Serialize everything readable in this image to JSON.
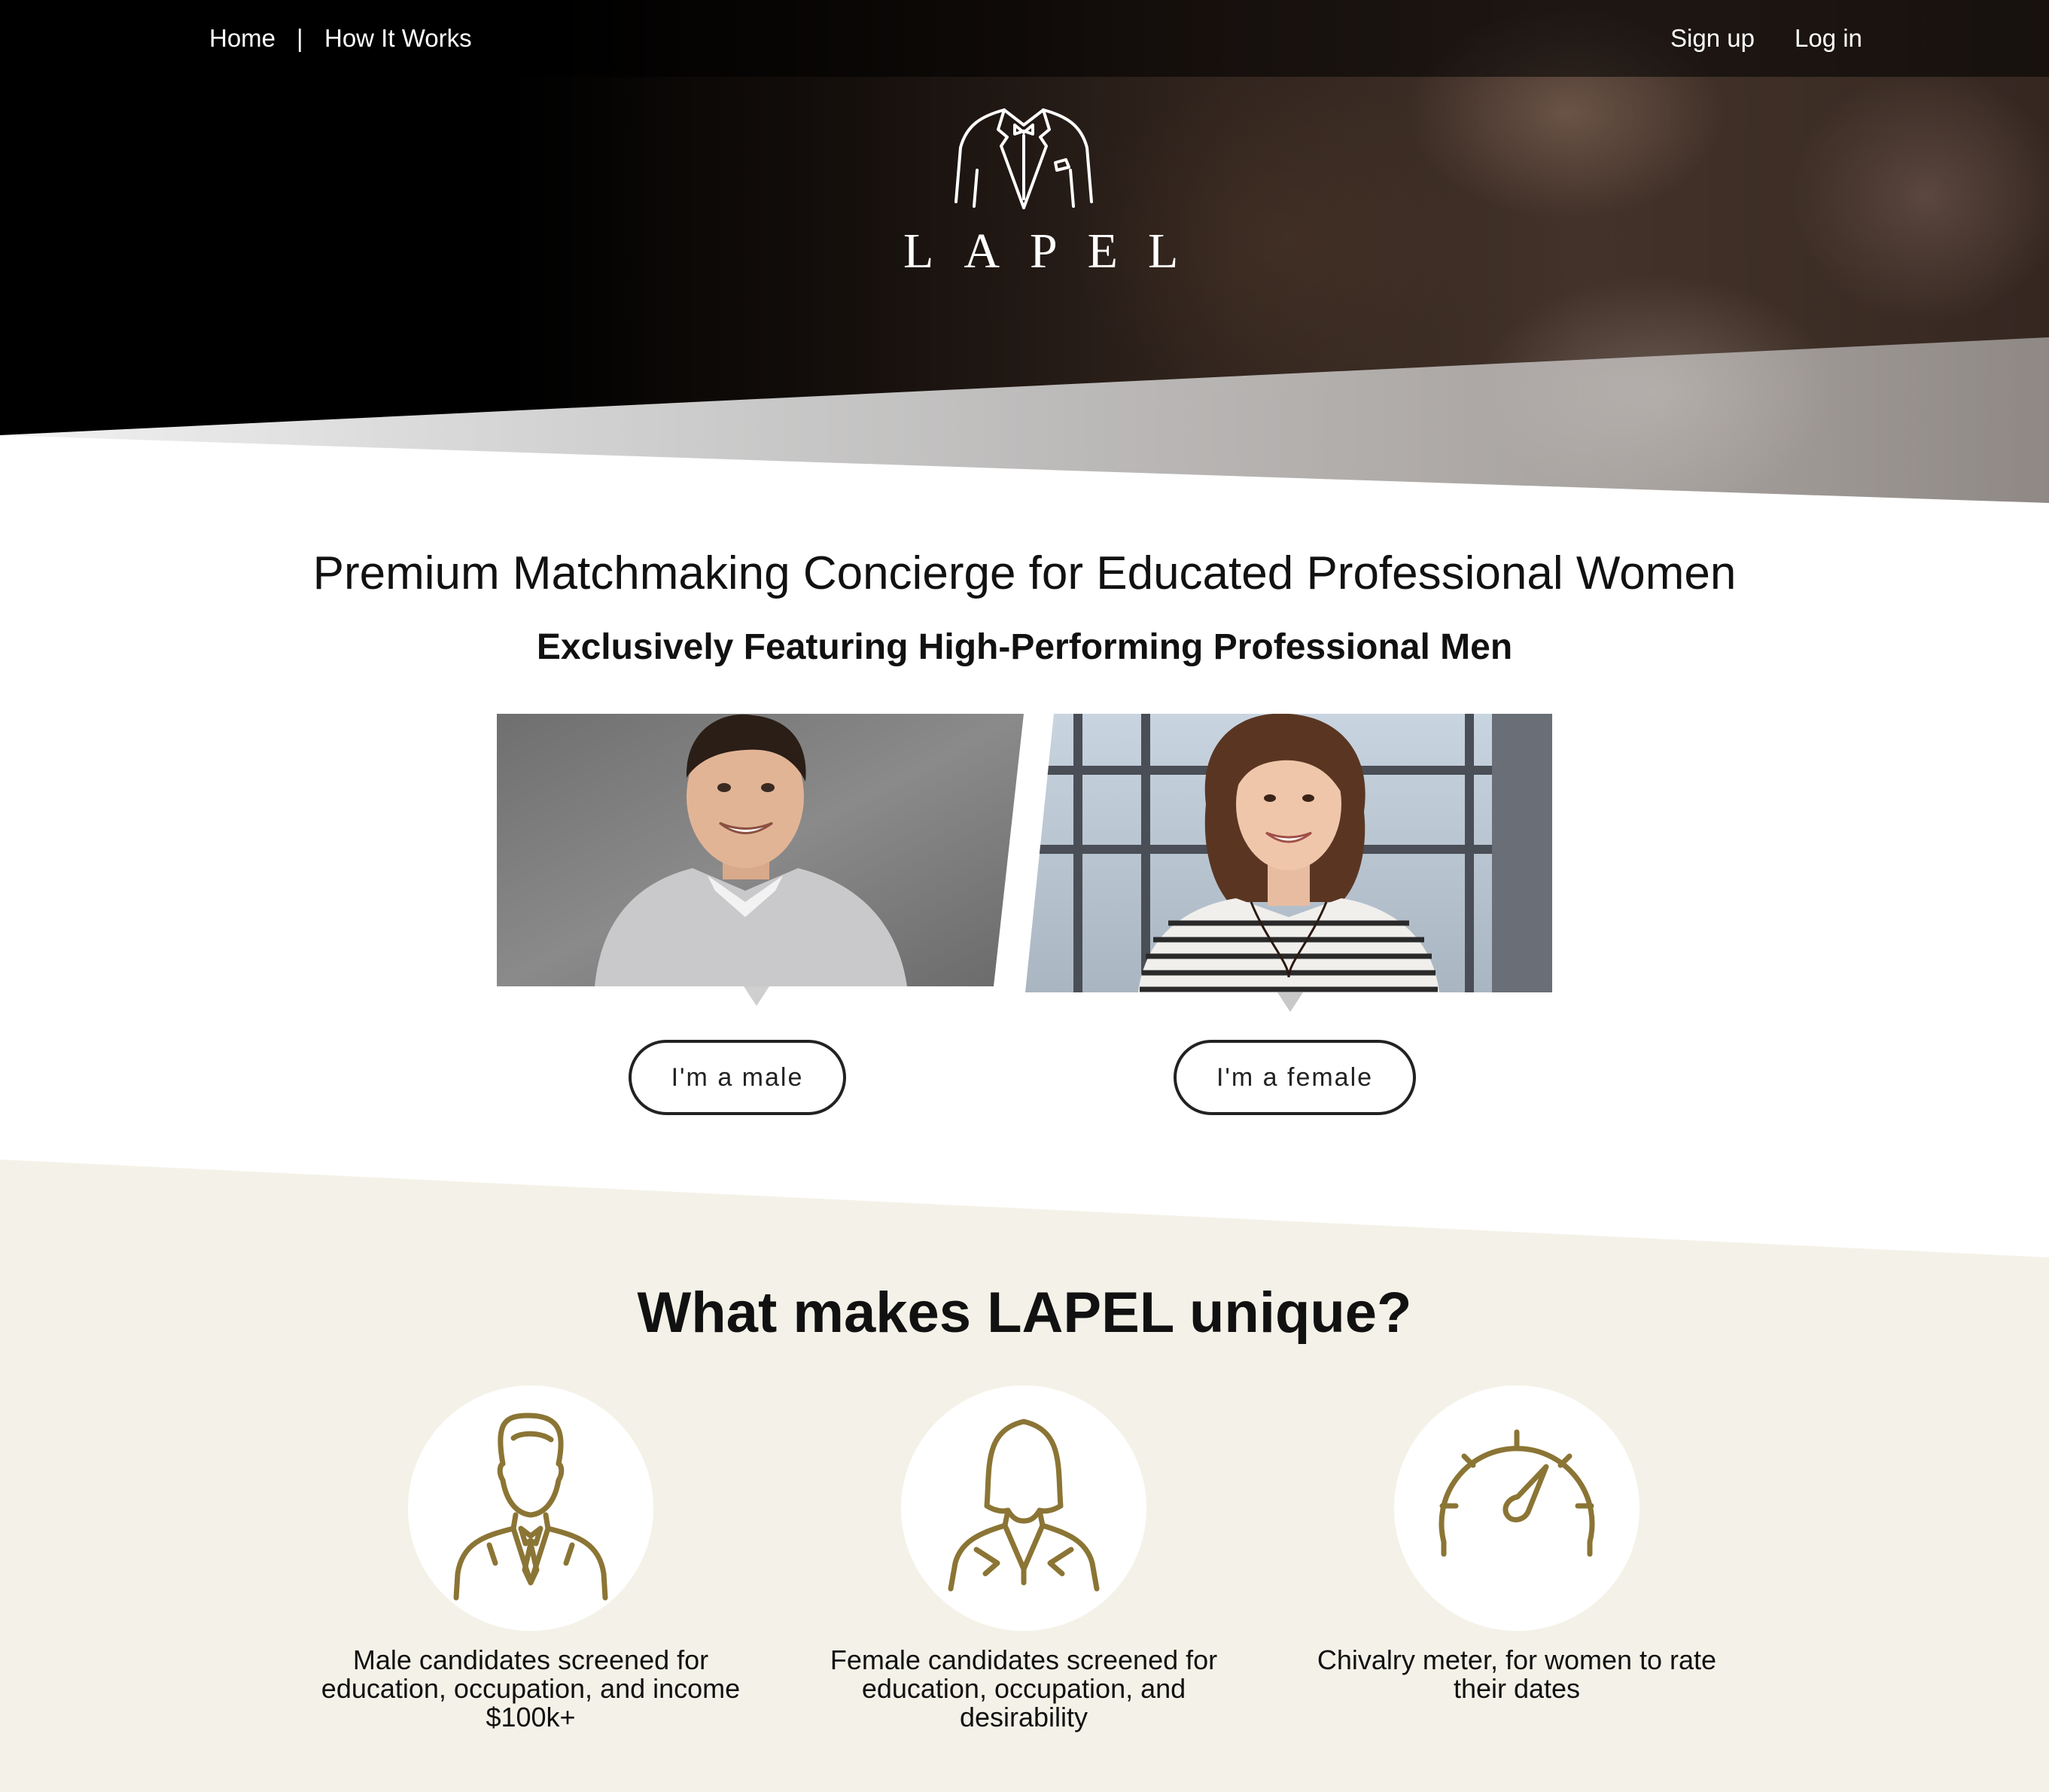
{
  "nav": {
    "home": "Home",
    "separator": "|",
    "how_it_works": "How It Works",
    "sign_up": "Sign up",
    "log_in": "Log in"
  },
  "brand": {
    "logo_text": "LAPEL"
  },
  "intro": {
    "headline": "Premium Matchmaking Concierge for Educated Professional Women",
    "subheadline": "Exclusively Featuring High-Performing Professional Men",
    "male_button": "I'm a male",
    "female_button": "I'm a female"
  },
  "unique": {
    "title": "What makes LAPEL unique?",
    "features": [
      {
        "icon": "businessman-icon",
        "text": "Male candidates screened for education, occupation, and income $100k+"
      },
      {
        "icon": "businesswoman-icon",
        "text": "Female candidates screened for education, occupation, and desirability"
      },
      {
        "icon": "speedometer-icon",
        "text": "Chivalry meter, for women to rate their dates"
      }
    ]
  },
  "colors": {
    "accent_gold": "#8b7535",
    "section_beige": "#f4f2e8",
    "hero_dark": "#000000"
  }
}
